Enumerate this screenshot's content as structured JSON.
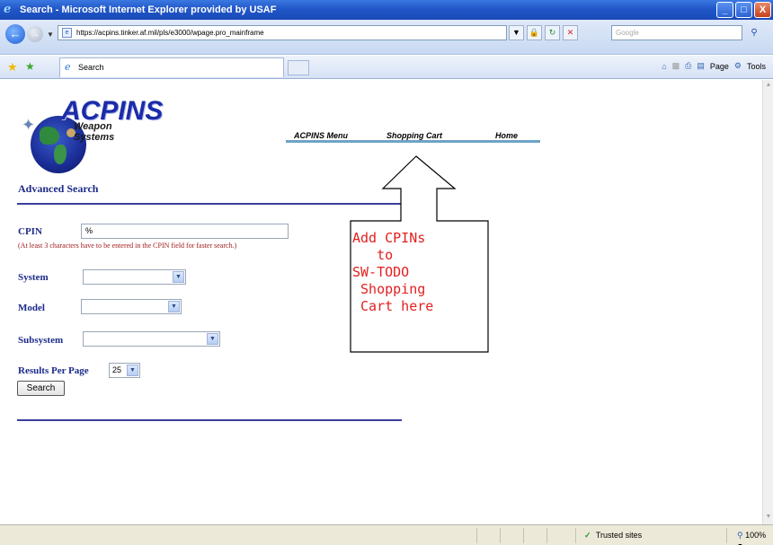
{
  "window": {
    "title": "Search - Microsoft Internet Explorer provided by USAF",
    "minimize": "_",
    "maximize": "□",
    "close": "X"
  },
  "addressbar": {
    "url": "https://acpins.tinker.af.mil/pls/e3000/wpage.pro_mainframe",
    "search_placeholder": "Google"
  },
  "tabbar": {
    "active_tab": "Search",
    "page_menu": "Page",
    "tools_menu": "Tools"
  },
  "logo": {
    "title": "ACPINS",
    "subtitle": "Weapon Systems"
  },
  "nav": {
    "items": [
      "ACPINS Menu",
      "Shopping Cart",
      "Home"
    ]
  },
  "page": {
    "heading": "Advanced Search"
  },
  "form": {
    "cpin_label": "CPIN",
    "cpin_value": "%",
    "cpin_note": "(At least 3 characters have to be entered in the CPIN field for faster search.)",
    "system_label": "System",
    "system_value": "",
    "model_label": "Model",
    "model_value": "",
    "subsystem_label": "Subsystem",
    "subsystem_value": "",
    "results_label": "Results Per Page",
    "results_value": "25",
    "search_button": "Search"
  },
  "annotation": {
    "text": "Add CPINs\n   to\nSW-TODO\n Shopping\n Cart here"
  },
  "status": {
    "zone": "Trusted sites",
    "zoom": "100%"
  },
  "colors": {
    "heading": "#1c2a8a",
    "note": "#a01c1c",
    "annotation": "#e32020",
    "nav_underline": "#6ea4c8"
  }
}
